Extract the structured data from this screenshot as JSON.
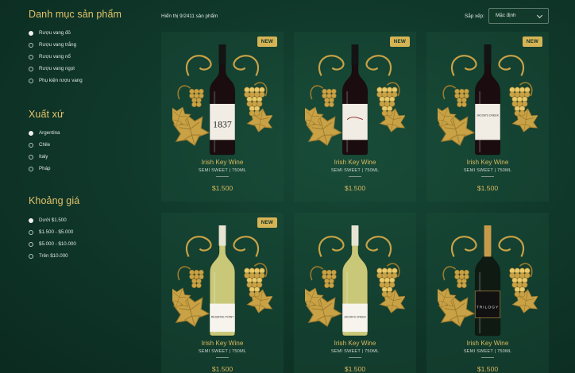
{
  "sidebar": {
    "categories": {
      "title": "Danh mục sản phẩm",
      "items": [
        "Rượu vang đỏ",
        "Rượu vang trắng",
        "Rượu vang nổ",
        "Rượu vang ngọt",
        "Phụ kiện rượu vang"
      ],
      "selected": 0
    },
    "origin": {
      "title": "Xuất xứ",
      "items": [
        "Argentina",
        "Chile",
        "Italy",
        "Pháp"
      ],
      "selected": 0
    },
    "price": {
      "title": "Khoảng giá",
      "items": [
        "Dưới $1.500",
        "$1.500 - $5.000",
        "$5.000 - $10.000",
        "Trên $10.000"
      ],
      "selected": 0
    }
  },
  "toolbar": {
    "result_count": "Hiển thị 9/2411 sản phẩm",
    "sort_label": "Sắp xếp:",
    "sort_value": "Mặc định"
  },
  "colors": {
    "accent": "#d7b85e",
    "badge": "#d6b455",
    "background": "#10392b"
  },
  "products": [
    {
      "name": "Irish Key Wine",
      "meta": "SEMI SWEET | 750ML",
      "price": "$1.500",
      "badge": "NEW",
      "wine": "red",
      "label_text": "1837"
    },
    {
      "name": "Irish Key Wine",
      "meta": "SEMI SWEET | 750ML",
      "price": "$1.500",
      "badge": "NEW",
      "wine": "red",
      "label_text": ""
    },
    {
      "name": "Irish Key Wine",
      "meta": "SEMI SWEET | 750ML",
      "price": "$1.500",
      "badge": "NEW",
      "wine": "red",
      "label_text": "JACOB'S CREEK"
    },
    {
      "name": "Irish Key Wine",
      "meta": "SEMI SWEET | 750ML",
      "price": "$1.500",
      "badge": "NEW",
      "wine": "white",
      "label_text": "RESERVE POINT"
    },
    {
      "name": "Irish Key Wine",
      "meta": "SEMI SWEET | 750ML",
      "price": "$1.500",
      "badge": "",
      "wine": "white",
      "label_text": "JACOB'S CREEK"
    },
    {
      "name": "Irish Key Wine",
      "meta": "SEMI SWEET | 750ML",
      "price": "$1.500",
      "badge": "",
      "wine": "sparkling",
      "label_text": "TRILOGY"
    }
  ]
}
